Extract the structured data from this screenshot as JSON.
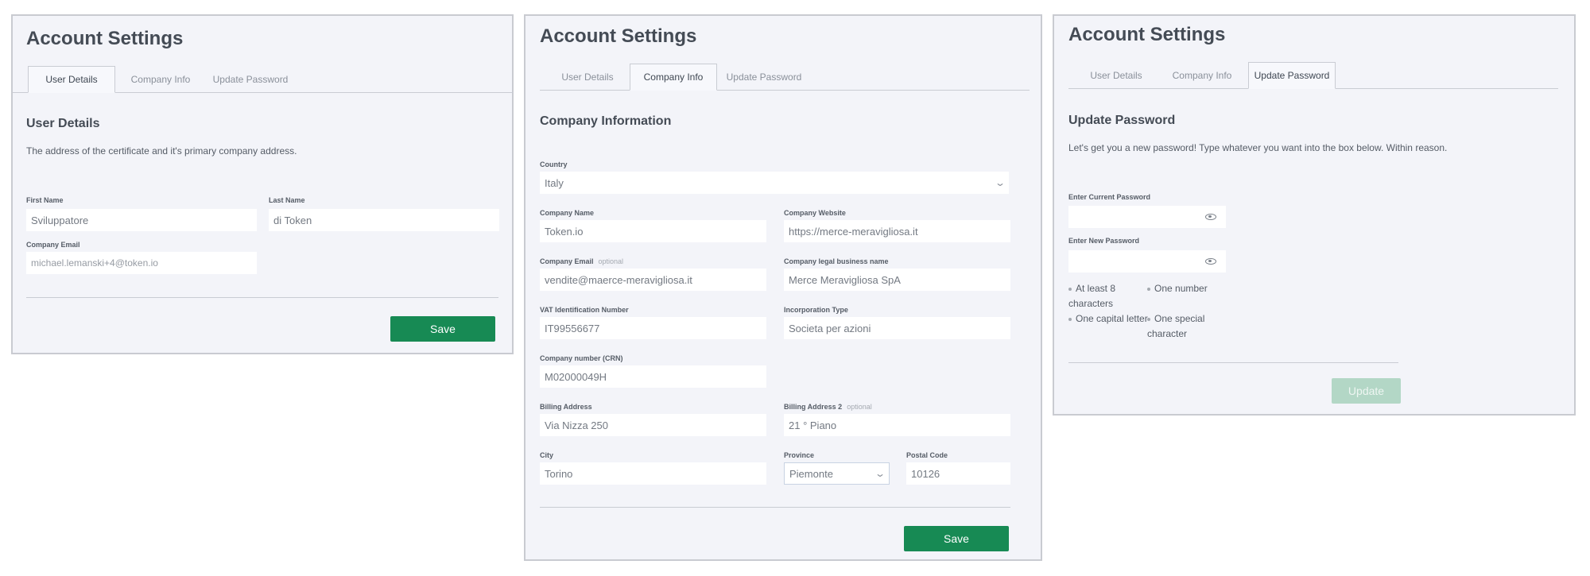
{
  "panels": {
    "user_details": {
      "title": "Account Settings",
      "tabs": [
        "User Details",
        "Company Info",
        "Update Password"
      ],
      "section_title": "User Details",
      "description": "The address of the certificate and it's primary company address.",
      "fields": {
        "first_name": {
          "label": "First Name",
          "value": "Sviluppatore"
        },
        "last_name": {
          "label": "Last Name",
          "value": "di Token"
        },
        "company_email": {
          "label": "Company Email",
          "value": "michael.lemanski+4@token.io"
        }
      },
      "save_label": "Save"
    },
    "company_info": {
      "title": "Account Settings",
      "tabs": [
        "User Details",
        "Company Info",
        "Update Password"
      ],
      "section_title": "Company Information",
      "optional_tag": "optional",
      "fields": {
        "country": {
          "label": "Country",
          "value": "Italy"
        },
        "company_name": {
          "label": "Company Name",
          "value": "Token.io"
        },
        "company_website": {
          "label": "Company Website",
          "value": "https://merce-meravigliosa.it"
        },
        "company_email": {
          "label": "Company Email",
          "value": "vendite@maerce-meravigliosa.it"
        },
        "legal_name": {
          "label": "Company legal business name",
          "value": "Merce Meravigliosa SpA"
        },
        "vat": {
          "label": "VAT Identification Number",
          "value": "IT99556677"
        },
        "incorporation": {
          "label": "Incorporation Type",
          "value": "Societa per azioni"
        },
        "crn": {
          "label": "Company number (CRN)",
          "value": "M02000049H"
        },
        "billing1": {
          "label": "Billing Address",
          "value": "Via Nizza 250"
        },
        "billing2": {
          "label": "Billing Address 2",
          "value": "21 ° Piano"
        },
        "city": {
          "label": "City",
          "value": "Torino"
        },
        "province": {
          "label": "Province",
          "value": "Piemonte"
        },
        "postal": {
          "label": "Postal Code",
          "value": "10126"
        }
      },
      "save_label": "Save"
    },
    "update_password": {
      "title": "Account Settings",
      "tabs": [
        "User Details",
        "Company Info",
        "Update Password"
      ],
      "section_title": "Update Password",
      "description": "Let's get you a new password! Type whatever you want into the box below. Within reason.",
      "current_label": "Enter Current Password",
      "new_label": "Enter New Password",
      "rules": {
        "r1_line1": "At least 8",
        "r1_line2": "characters",
        "r2": "One number",
        "r3": "One capital letter",
        "r4_line1": "One special",
        "r4_line2": "character"
      },
      "update_label": "Update"
    }
  },
  "icons": {
    "select": "chevron-down-icon",
    "password": "eye-icon",
    "rule": "bullet-icon"
  },
  "colors": {
    "primary": "#178a54",
    "primary_disabled": "#b3d7c6",
    "panel_bg": "#f3f4f9"
  }
}
